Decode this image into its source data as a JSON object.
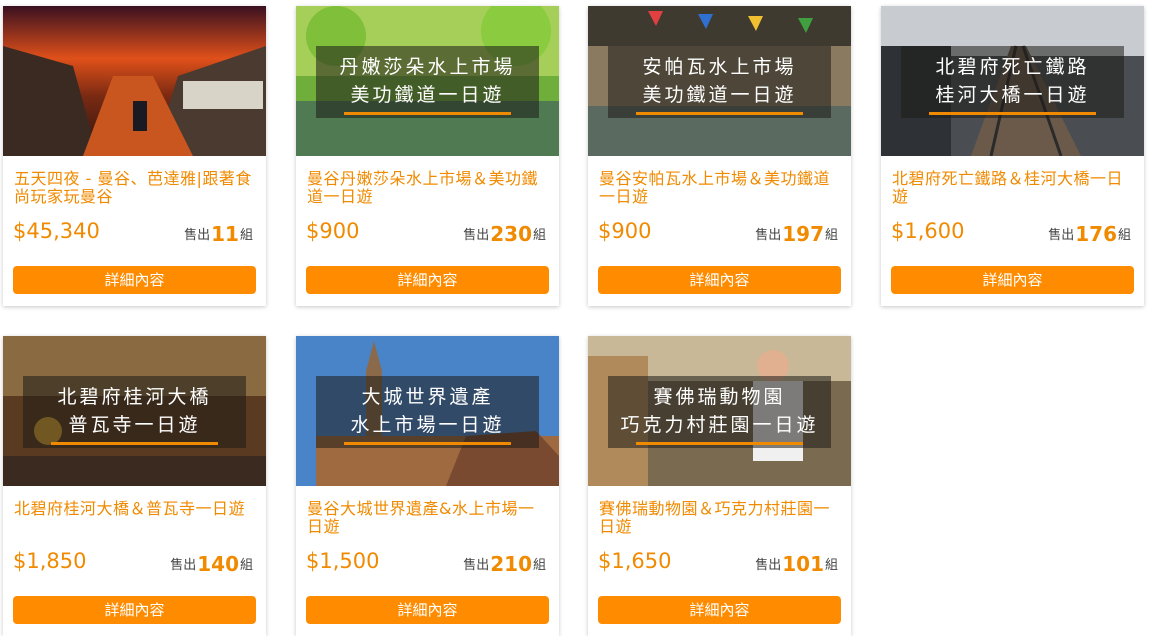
{
  "cards": [
    {
      "title": "五天四夜 - 曼谷、芭達雅|跟著食尚玩家玩曼谷",
      "banner": [
        "",
        ""
      ],
      "price": "$45,340",
      "sold_prefix": "售出",
      "sold_count": "11",
      "sold_suffix": "組",
      "button": "詳細內容"
    },
    {
      "title": "曼谷丹嫩莎朵水上市場＆美功鐵道一日遊",
      "banner": [
        "丹嫩莎朵水上市場",
        "美功鐵道一日遊"
      ],
      "price": "$900",
      "sold_prefix": "售出",
      "sold_count": "230",
      "sold_suffix": "組",
      "button": "詳細內容"
    },
    {
      "title": "曼谷安帕瓦水上市場＆美功鐵道一日遊",
      "banner": [
        "安帕瓦水上市場",
        "美功鐵道一日遊"
      ],
      "price": "$900",
      "sold_prefix": "售出",
      "sold_count": "197",
      "sold_suffix": "組",
      "button": "詳細內容"
    },
    {
      "title": "北碧府死亡鐵路＆桂河大橋一日遊",
      "banner": [
        "北碧府死亡鐵路",
        "桂河大橋一日遊"
      ],
      "price": "$1,600",
      "sold_prefix": "售出",
      "sold_count": "176",
      "sold_suffix": "組",
      "button": "詳細內容"
    },
    {
      "title": "北碧府桂河大橋＆普瓦寺一日遊",
      "banner": [
        "北碧府桂河大橋",
        "普瓦寺一日遊"
      ],
      "price": "$1,850",
      "sold_prefix": "售出",
      "sold_count": "140",
      "sold_suffix": "組",
      "button": "詳細內容"
    },
    {
      "title": "曼谷大城世界遺產&水上市場一日遊",
      "banner": [
        "大城世界遺產",
        "水上市場一日遊"
      ],
      "price": "$1,500",
      "sold_prefix": "售出",
      "sold_count": "210",
      "sold_suffix": "組",
      "button": "詳細內容"
    },
    {
      "title": "賽佛瑞動物園＆巧克力村莊園一日遊",
      "banner": [
        "賽佛瑞動物園",
        "巧克力村莊園一日遊"
      ],
      "price": "$1,650",
      "sold_prefix": "售出",
      "sold_count": "101",
      "sold_suffix": "組",
      "button": "詳細內容"
    }
  ]
}
